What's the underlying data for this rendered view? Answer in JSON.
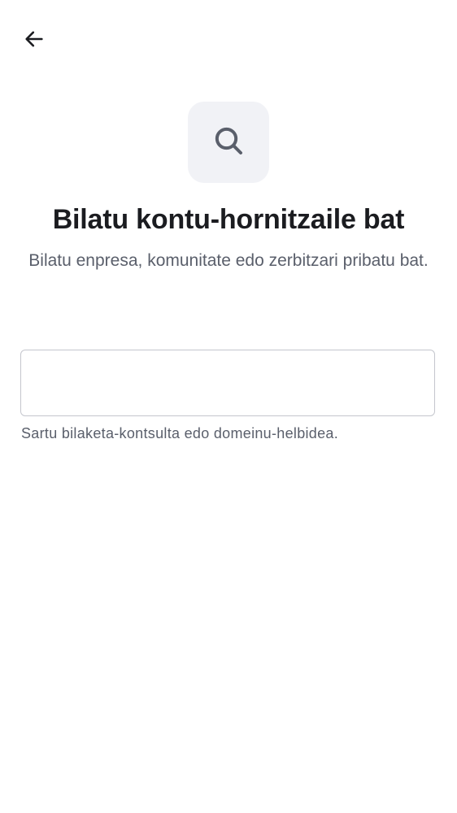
{
  "header": {
    "back_icon": "arrow-left-icon"
  },
  "hero": {
    "icon": "search-icon",
    "tile_color": "#f1f2f6",
    "icon_color": "#5a5f6b"
  },
  "content": {
    "title": "Bilatu kontu-hornitzaile bat",
    "subtitle": "Bilatu enpresa, komunitate edo zerbitzari pribatu bat."
  },
  "search": {
    "value": "",
    "placeholder": "",
    "helper": "Sartu bilaketa-kontsulta edo domeinu-helbidea."
  }
}
